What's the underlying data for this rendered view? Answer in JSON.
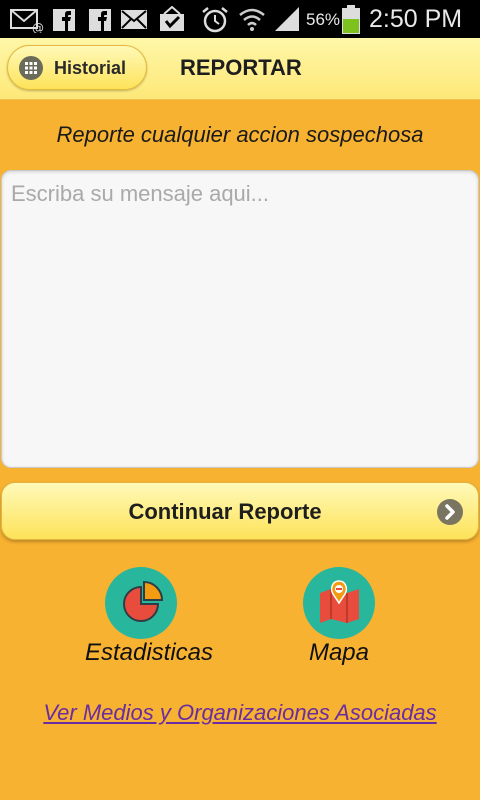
{
  "status_bar": {
    "battery_percent": "56%",
    "time": "2:50 PM",
    "icons": [
      "gmail-icon",
      "facebook-icon",
      "facebook-icon",
      "email-icon",
      "checkbox-icon",
      "alarm-icon",
      "wifi-icon",
      "signal-icon",
      "battery-icon"
    ]
  },
  "header": {
    "history_label": "Historial",
    "title": "REPORTAR"
  },
  "main": {
    "instruction": "Reporte cualquier accion sospechosa",
    "message_placeholder": "Escriba su mensaje aqui...",
    "message_value": "",
    "continue_label": "Continuar Reporte",
    "tiles": [
      {
        "label": "Estadisticas",
        "icon": "pie-chart-icon"
      },
      {
        "label": "Mapa",
        "icon": "map-icon"
      }
    ],
    "link": "Ver Medios y Organizaciones Asociadas"
  },
  "colors": {
    "background": "#f8b231",
    "tile_circle": "#28b69c",
    "link": "#6a2da0"
  }
}
